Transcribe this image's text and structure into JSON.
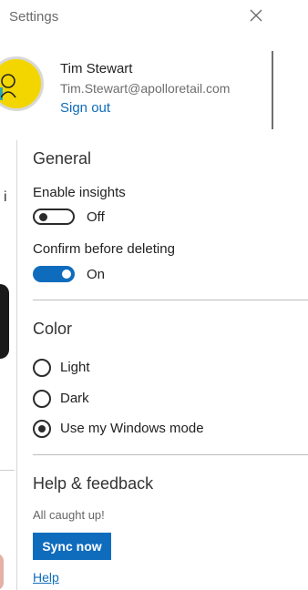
{
  "header": {
    "title": "Settings",
    "close_icon": "close-icon"
  },
  "account": {
    "name": "Tim Stewart",
    "email": "Tim.Stewart@apolloretail.com",
    "sign_out": "Sign out",
    "avatar_color": "#f3d600"
  },
  "background": {
    "letter": "i"
  },
  "general": {
    "heading": "General",
    "insights": {
      "label": "Enable insights",
      "state": "Off",
      "on": false
    },
    "confirm_delete": {
      "label": "Confirm before deleting",
      "state": "On",
      "on": true
    }
  },
  "color": {
    "heading": "Color",
    "options": [
      {
        "label": "Light",
        "selected": false
      },
      {
        "label": "Dark",
        "selected": false
      },
      {
        "label": "Use my Windows mode",
        "selected": true
      }
    ]
  },
  "help": {
    "heading": "Help & feedback",
    "status": "All caught up!",
    "sync_label": "Sync now",
    "help_link": "Help"
  },
  "colors": {
    "accent": "#0f6cbd",
    "text": "#222222",
    "muted": "#6d6d6d"
  }
}
